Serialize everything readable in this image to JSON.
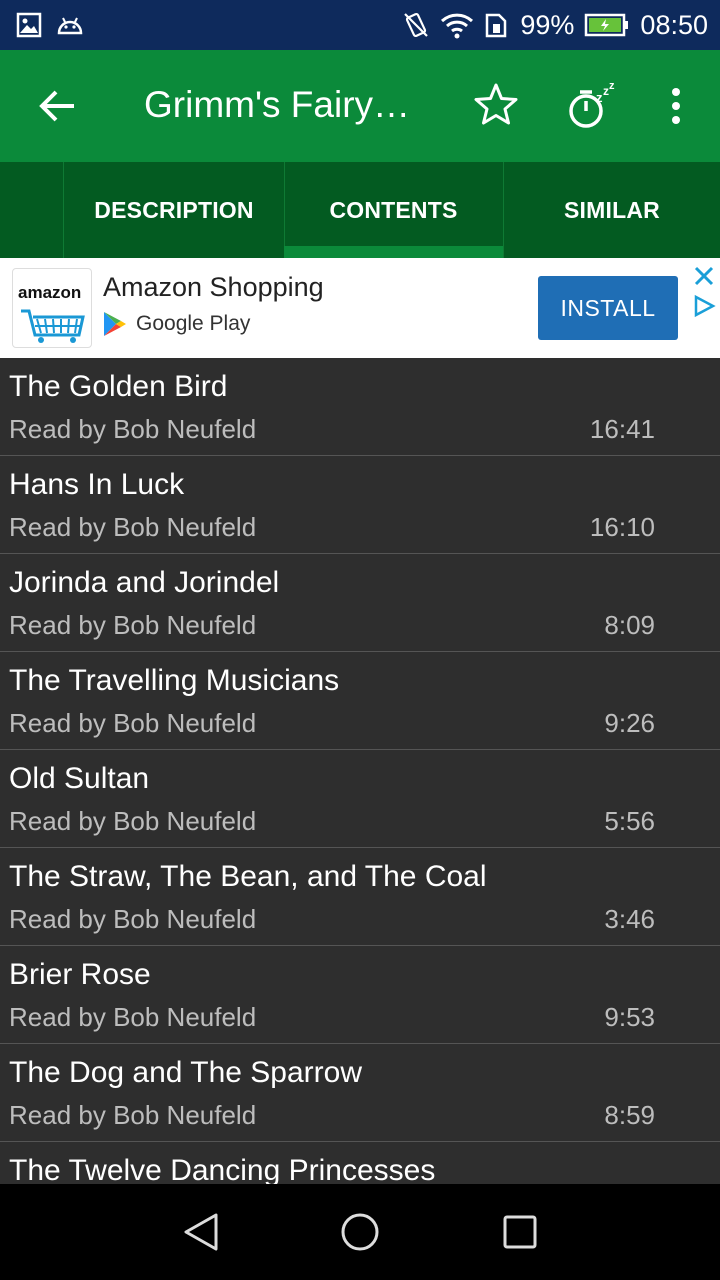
{
  "status_bar": {
    "battery_percent": "99%",
    "time": "08:50",
    "icons": [
      "gallery-icon",
      "android-icon",
      "vibrate-icon",
      "wifi-icon",
      "sim-icon",
      "battery-icon"
    ]
  },
  "app_bar": {
    "title": "Grimm's Fairy…",
    "icons": [
      "back-arrow-icon",
      "star-icon",
      "sleep-timer-icon",
      "more-vert-icon"
    ],
    "color": "#0b8a3a"
  },
  "tabs": [
    {
      "label": "DESCRIPTION",
      "selected": false
    },
    {
      "label": "CONTENTS",
      "selected": true
    },
    {
      "label": "SIMILAR",
      "selected": false
    }
  ],
  "ad": {
    "logo_text": "amazon",
    "app_name": "Amazon Shopping",
    "store_name": "Google Play",
    "install_label": "INSTALL"
  },
  "chapters": [
    {
      "title": "The Golden Bird",
      "reader": "Read by Bob Neufeld",
      "duration": "16:41"
    },
    {
      "title": "Hans In Luck",
      "reader": "Read by Bob Neufeld",
      "duration": "16:10"
    },
    {
      "title": "Jorinda and Jorindel",
      "reader": "Read by Bob Neufeld",
      "duration": "8:09"
    },
    {
      "title": "The Travelling Musicians",
      "reader": "Read by Bob Neufeld",
      "duration": "9:26"
    },
    {
      "title": "Old Sultan",
      "reader": "Read by Bob Neufeld",
      "duration": "5:56"
    },
    {
      "title": "The Straw, The Bean, and The Coal",
      "reader": "Read by Bob Neufeld",
      "duration": "3:46"
    },
    {
      "title": "Brier Rose",
      "reader": "Read by Bob Neufeld",
      "duration": "9:53"
    },
    {
      "title": "The Dog and The Sparrow",
      "reader": "Read by Bob Neufeld",
      "duration": "8:59"
    },
    {
      "title": "The Twelve Dancing Princesses",
      "reader": "",
      "duration": ""
    }
  ],
  "nav_bar": {
    "icons": [
      "back-triangle-icon",
      "home-circle-icon",
      "recents-square-icon"
    ]
  }
}
